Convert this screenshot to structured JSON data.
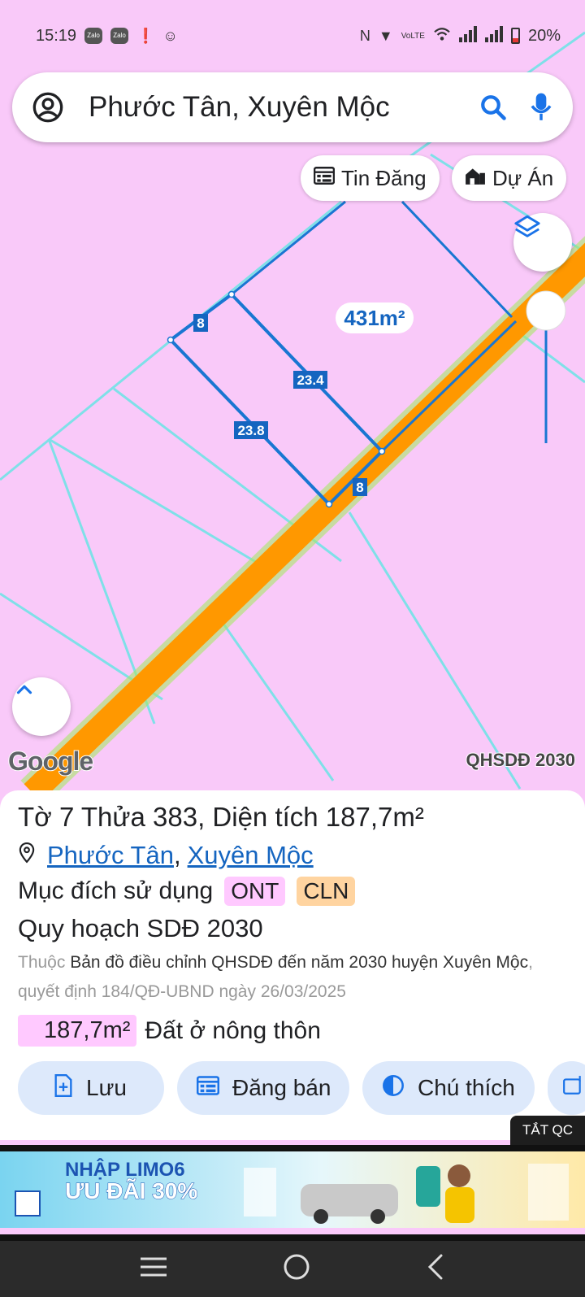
{
  "status_bar": {
    "time": "15:19",
    "notif_chips": [
      "Zalo",
      "Zalo"
    ],
    "battery": "20%"
  },
  "search": {
    "query": "Phước Tân, Xuyên Mộc"
  },
  "map_buttons": {
    "tin_dang": "Tin Đăng",
    "du_an": "Dự Án"
  },
  "map": {
    "area_label": "431m²",
    "edge_labels": [
      "8",
      "23.4",
      "23.8",
      "8"
    ],
    "google_logo": "Google",
    "plan_label": "QHSDĐ 2030"
  },
  "panel": {
    "title": "Tờ 7 Thửa 383, Diện tích 187,7m²",
    "location_ward": "Phước Tân",
    "location_sep": ",",
    "location_district": "Xuyên Mộc",
    "purpose_label": "Mục đích sử dụng",
    "purpose_badges": [
      "ONT",
      "CLN"
    ],
    "plan_title": "Quy hoạch SDĐ 2030",
    "desc_prefix": "Thuộc",
    "desc_main": "Bản đồ điều chỉnh QHSDĐ đến năm 2030 huyện Xuyên Mộc",
    "desc_suffix": ", quyết định 184/QĐ-UBND ngày 26/03/2025",
    "area_value": "187,7m²",
    "land_type": "Đất ở nông thôn",
    "actions": [
      "Lưu",
      "Đăng bán",
      "Chú thích"
    ]
  },
  "ad": {
    "close_label": "TẮT QC",
    "line1": "NHẬP LIMO6",
    "line2": "ƯU ĐÃI 30%"
  },
  "colors": {
    "map_background": "#f9c9f9",
    "road": "#ff9800",
    "parcel_line": "#1565c0",
    "boundary_line": "#7fe0e8",
    "accent": "#1a73e8"
  }
}
